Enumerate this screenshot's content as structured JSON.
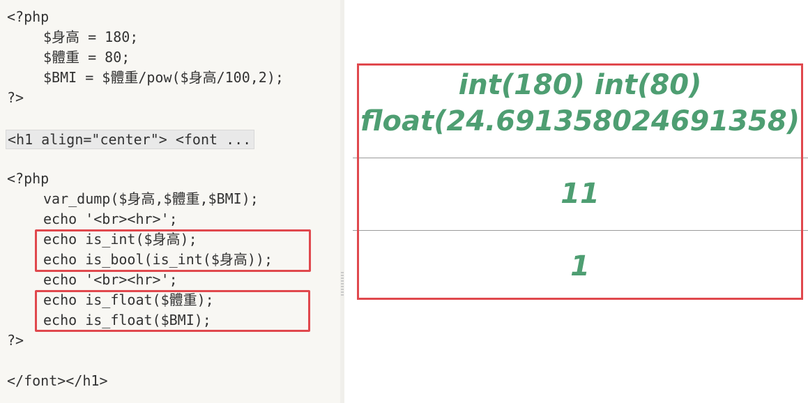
{
  "editor": {
    "lines": {
      "l1": "<?php",
      "l2": "$身高 = 180;",
      "l3": "$體重 = 80;",
      "l4": "$BMI = $體重/pow($身高/100,2);",
      "l5": "?>",
      "l6": "<h1 align=\"center\"> <font ...",
      "l7": "<?php",
      "l8": "var_dump($身高,$體重,$BMI);",
      "l9": "echo '<br><hr>';",
      "l10": "echo is_int($身高);",
      "l11": "echo is_bool(is_int($身高));",
      "l12": "echo '<br><hr>';",
      "l13": "echo is_float($體重);",
      "l14": "echo is_float($BMI);",
      "l15": "?>",
      "l16": "</font></h1>"
    }
  },
  "output": {
    "line1": "int(180) int(80)",
    "line2": "float(24.691358024691358)",
    "line3": "11",
    "line4": "1"
  },
  "colors": {
    "output_text": "#4e9e72",
    "highlight": "#e0484d",
    "editor_bg": "#f8f7f3"
  }
}
